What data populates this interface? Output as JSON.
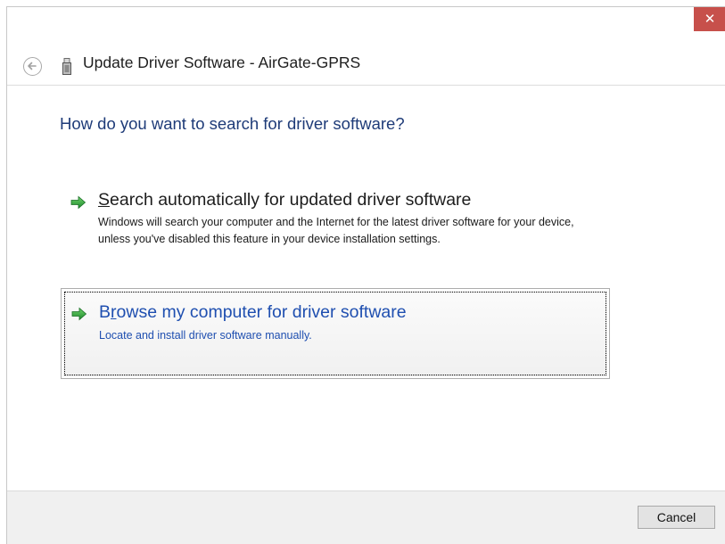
{
  "window": {
    "title": "Update Driver Software - AirGate-GPRS",
    "close_glyph": "✕"
  },
  "icons": {
    "back": "back-arrow-icon",
    "device": "usb-device-icon",
    "option_arrow": "green-arrow-icon"
  },
  "main": {
    "question": "How do you want to search for driver software?",
    "options": [
      {
        "title_accel": "S",
        "title_rest": "earch automatically for updated driver software",
        "description": "Windows will search your computer and the Internet for the latest driver software for your device, unless you've disabled this feature in your device installation settings."
      },
      {
        "title_accel": "r",
        "title_pre": "B",
        "title_rest": "owse my computer for driver software",
        "description": "Locate and install driver software manually."
      }
    ]
  },
  "footer": {
    "cancel_label": "Cancel"
  },
  "colors": {
    "close": "#c7504b",
    "heading_blue": "#1e3b78",
    "link_blue": "#1f4fb0",
    "arrow_green": "#2e9e3e",
    "footer_bg": "#f0f0f0"
  }
}
